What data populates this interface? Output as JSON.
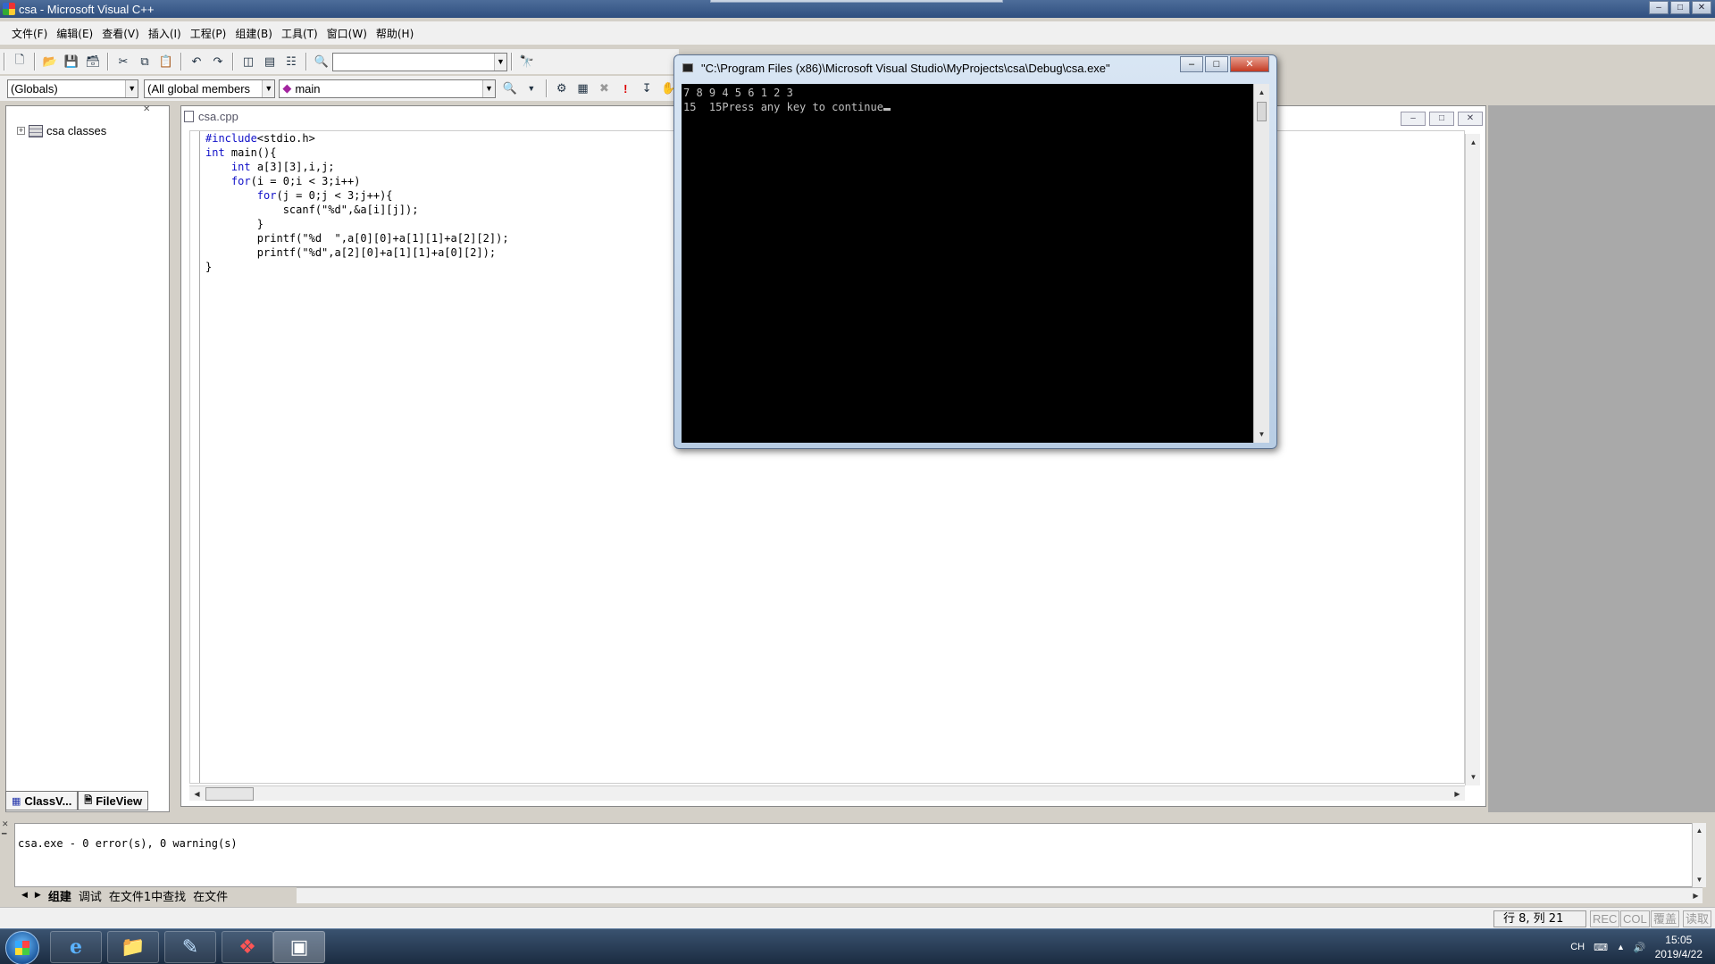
{
  "window": {
    "title": "csa - Microsoft Visual C++",
    "controls": [
      "–",
      "□",
      "✕"
    ]
  },
  "menu": [
    "文件(F)",
    "编辑(E)",
    "查看(V)",
    "插入(I)",
    "工程(P)",
    "组建(B)",
    "工具(T)",
    "窗口(W)",
    "帮助(H)"
  ],
  "toolbar": {
    "find_combo_value": "",
    "scope_combo": "(Globals)",
    "members_combo": "(All global members",
    "function_combo": "main"
  },
  "workspace": {
    "tree_root": "csa classes",
    "tabs": [
      "ClassV...",
      "FileView"
    ]
  },
  "document": {
    "filename": "csa.cpp",
    "code_lines": [
      [
        {
          "k": true,
          "t": "#include"
        },
        {
          "t": "<stdio.h>"
        }
      ],
      [
        {
          "k": true,
          "t": "int"
        },
        {
          "t": " main(){"
        }
      ],
      [
        {
          "t": "    "
        },
        {
          "k": true,
          "t": "int"
        },
        {
          "t": " a[3][3],i,j;"
        }
      ],
      [
        {
          "t": "    "
        },
        {
          "k": true,
          "t": "for"
        },
        {
          "t": "(i = 0;i < 3;i++)"
        }
      ],
      [
        {
          "t": "        "
        },
        {
          "k": true,
          "t": "for"
        },
        {
          "t": "(j = 0;j < 3;j++){"
        }
      ],
      [
        {
          "t": "            scanf(\"%d\",&a[i][j]);"
        }
      ],
      [
        {
          "t": "        }"
        }
      ],
      [
        {
          "t": "        printf(\"%d  \",a[0][0]+a[1][1]+a[2][2]);"
        }
      ],
      [
        {
          "t": "        printf(\"%d\",a[2][0]+a[1][1]+a[0][2]);"
        }
      ],
      [
        {
          "t": "}"
        }
      ]
    ]
  },
  "console": {
    "title": "\"C:\\Program Files (x86)\\Microsoft Visual Studio\\MyProjects\\csa\\Debug\\csa.exe\"",
    "line1": "7 8 9 4 5 6 1 2 3",
    "line2": "15  15Press any key to continue"
  },
  "output": {
    "text": "csa.exe - 0 error(s), 0 warning(s)",
    "tabs": [
      "组建",
      "调试",
      "在文件1中查找",
      "在文件"
    ]
  },
  "status": {
    "position": "行 8, 列 21",
    "indicators": [
      "REC",
      "COL",
      "覆盖",
      "读取"
    ]
  },
  "taskbar": {
    "tray_lang": "CH",
    "time": "15:05",
    "date": "2019/4/22"
  }
}
